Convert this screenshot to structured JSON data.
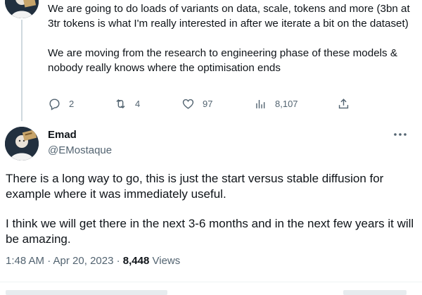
{
  "previous_tweet": {
    "paragraphs": [
      "We are going to do loads of variants on data, scale, tokens and more (3bn at 3tr tokens is what I'm really interested in after we iterate a bit on the dataset)",
      "We are moving from the research to engineering phase of these models & nobody really knows where the optimisation ends"
    ],
    "actions": {
      "reply_icon": "reply-icon",
      "reply_count": "2",
      "retweet_icon": "retweet-icon",
      "retweet_count": "4",
      "like_icon": "heart-icon",
      "like_count": "97",
      "views_icon": "analytics-icon",
      "views_count": "8,107",
      "share_icon": "share-icon"
    }
  },
  "main_tweet": {
    "author": {
      "name": "Emad",
      "handle": "@EMostaque"
    },
    "more_icon": "more-icon",
    "paragraphs": [
      "There is a long way to go, this is just the start versus stable diffusion for example where it was immediately useful.",
      "I think we will get there in the next 3-6 months and in the next few years it will be amazing."
    ],
    "meta": {
      "timestamp": "1:48 AM · Apr 20, 2023",
      "separator": " · ",
      "views_count": "8,448",
      "views_label": "Views"
    }
  },
  "colors": {
    "text": "#0f1419",
    "secondary": "#536471",
    "thread_line": "#cfd9de"
  }
}
